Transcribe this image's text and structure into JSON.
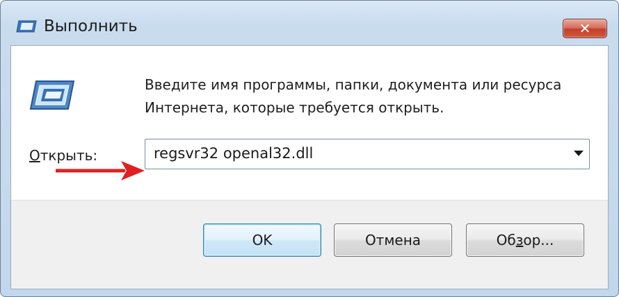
{
  "window": {
    "title": "Выполнить",
    "close_glyph": "✕"
  },
  "icons": {
    "title_icon": "run-dialog-icon",
    "main_icon": "run-program-icon"
  },
  "instruction_text": "Введите имя программы, папки, документа или ресурса Интернета, которые требуется открыть.",
  "open": {
    "label_prefix": "",
    "label_accel": "О",
    "label_rest": "ткрыть:",
    "value": "regsvr32 openal32.dll"
  },
  "buttons": {
    "ok": "OK",
    "cancel": "Отмена",
    "browse_prefix": "Об",
    "browse_accel": "з",
    "browse_rest": "ор..."
  },
  "annotation": {
    "arrow_color": "#e02020"
  }
}
